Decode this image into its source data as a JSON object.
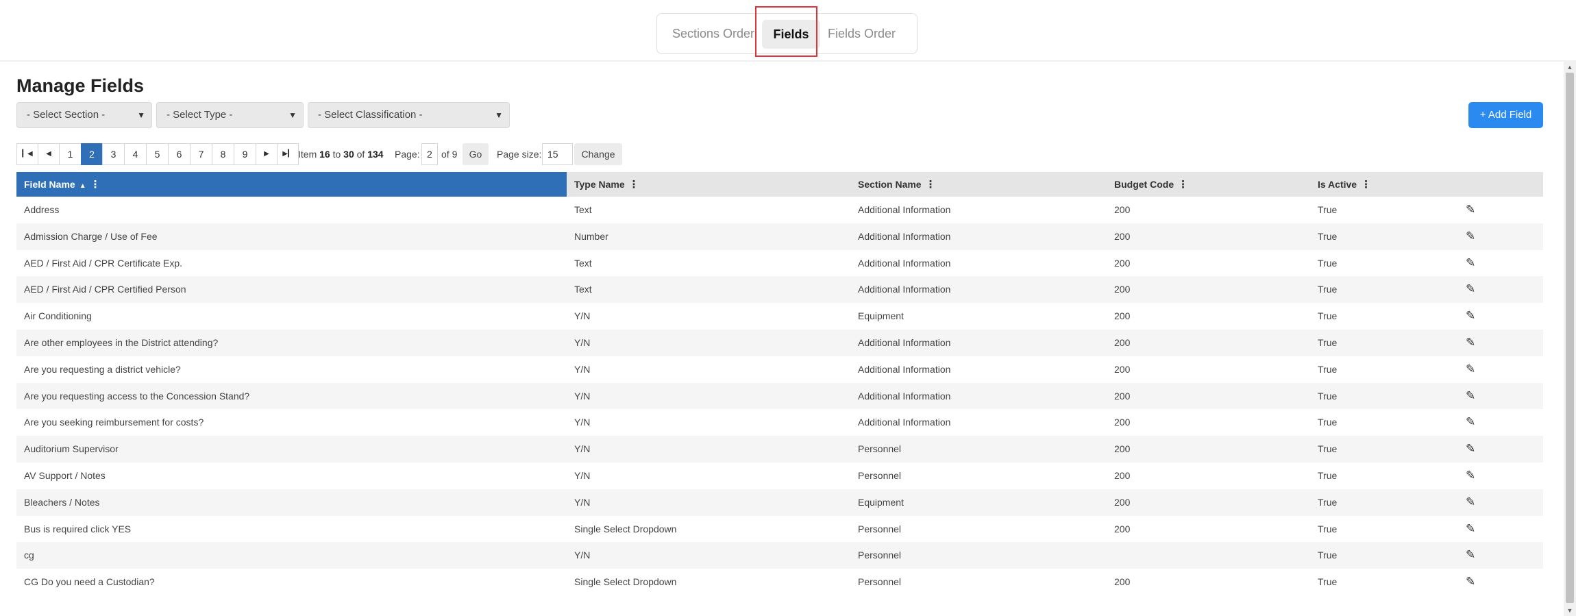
{
  "tabs": {
    "sections_order": "Sections Order",
    "fields": "Fields",
    "fields_order": "Fields Order"
  },
  "page_title": "Manage Fields",
  "filters": {
    "section": "- Select Section -",
    "type": "- Select Type -",
    "classification": "- Select Classification -"
  },
  "add_button": "+ Add Field",
  "pager": {
    "pages": [
      "1",
      "2",
      "3",
      "4",
      "5",
      "6",
      "7",
      "8",
      "9"
    ],
    "current_page": "2",
    "item_label": "Item",
    "item_from": "16",
    "to_label": "to",
    "item_to": "30",
    "of_label": "of",
    "item_total": "134",
    "page_label": "Page:",
    "page_value": "2",
    "of_pages": "of 9",
    "go_label": "Go",
    "page_size_label": "Page size:",
    "page_size_value": "15",
    "change_label": "Change"
  },
  "columns": {
    "field_name": "Field Name",
    "type_name": "Type Name",
    "section_name": "Section Name",
    "budget_code": "Budget Code",
    "is_active": "Is Active"
  },
  "rows": [
    {
      "field": "Address",
      "type": "Text",
      "section": "Additional Information",
      "budget": "200",
      "active": "True"
    },
    {
      "field": "Admission Charge / Use of Fee",
      "type": "Number",
      "section": "Additional Information",
      "budget": "200",
      "active": "True"
    },
    {
      "field": "AED / First Aid / CPR Certificate Exp.",
      "type": "Text",
      "section": "Additional Information",
      "budget": "200",
      "active": "True"
    },
    {
      "field": "AED / First Aid / CPR Certified Person",
      "type": "Text",
      "section": "Additional Information",
      "budget": "200",
      "active": "True"
    },
    {
      "field": "Air Conditioning",
      "type": "Y/N",
      "section": "Equipment",
      "budget": "200",
      "active": "True"
    },
    {
      "field": "Are other employees in the District attending?",
      "type": "Y/N",
      "section": "Additional Information",
      "budget": "200",
      "active": "True"
    },
    {
      "field": "Are you requesting a district vehicle?",
      "type": "Y/N",
      "section": "Additional Information",
      "budget": "200",
      "active": "True"
    },
    {
      "field": "Are you requesting access to the Concession Stand?",
      "type": "Y/N",
      "section": "Additional Information",
      "budget": "200",
      "active": "True"
    },
    {
      "field": "Are you seeking reimbursement for costs?",
      "type": "Y/N",
      "section": "Additional Information",
      "budget": "200",
      "active": "True"
    },
    {
      "field": "Auditorium Supervisor",
      "type": "Y/N",
      "section": "Personnel",
      "budget": "200",
      "active": "True"
    },
    {
      "field": "AV Support / Notes",
      "type": "Y/N",
      "section": "Personnel",
      "budget": "200",
      "active": "True"
    },
    {
      "field": "Bleachers / Notes",
      "type": "Y/N",
      "section": "Equipment",
      "budget": "200",
      "active": "True"
    },
    {
      "field": "Bus is required click YES",
      "type": "Single Select Dropdown",
      "section": "Personnel",
      "budget": "200",
      "active": "True"
    },
    {
      "field": "cg",
      "type": "Y/N",
      "section": "Personnel",
      "budget": "",
      "active": "True"
    },
    {
      "field": "CG Do you need a Custodian?",
      "type": "Single Select Dropdown",
      "section": "Personnel",
      "budget": "200",
      "active": "True"
    }
  ],
  "icons": {
    "edit": "pencil-icon",
    "sort": "sort-ascending-icon",
    "column_menu": "kebab-menu-icon"
  },
  "colors": {
    "accent": "#2f6fb7",
    "add_button": "#2a8af0",
    "highlight_box": "#e0343a"
  }
}
